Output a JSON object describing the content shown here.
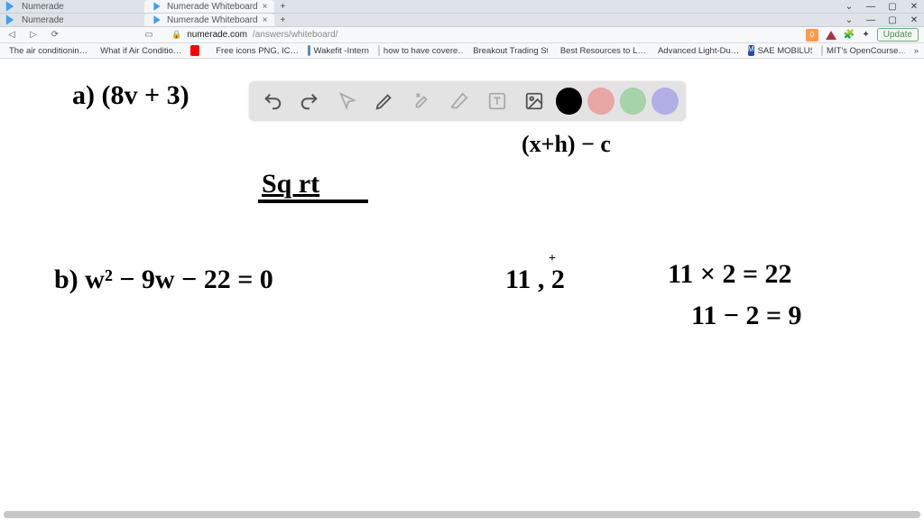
{
  "window_rows": [
    {
      "app_title": "Numerade",
      "tab_title": "Numerade Whiteboard"
    },
    {
      "app_title": "Numerade",
      "tab_title": "Numerade Whiteboard"
    }
  ],
  "window_buttons": {
    "down": "⌄",
    "min": "—",
    "max": "▢",
    "close": "✕"
  },
  "urlbar": {
    "back": "◁",
    "fwd": "▷",
    "reload": "⟳",
    "reader": "▭",
    "lock": "🔒",
    "domain": "numerade.com",
    "path": "/answers/whiteboard/",
    "shield": "0",
    "update_label": "Update"
  },
  "bookmarks": [
    {
      "label": "The air conditionin…",
      "color": "#2aa56a"
    },
    {
      "label": "What if Air Conditio…",
      "color": "#222"
    },
    {
      "label": "",
      "color": "#ff0000"
    },
    {
      "label": "Free icons PNG, IC…",
      "color": "#2bd46b"
    },
    {
      "label": "Wakefit -Intern",
      "color": "#5b89c9"
    },
    {
      "label": "how to have covere…",
      "color": "#4285f4"
    },
    {
      "label": "Breakout Trading St…",
      "color": "transparent"
    },
    {
      "label": "Best Resources to L…",
      "color": "#8866aa"
    },
    {
      "label": "Advanced Light-Du…",
      "color": "#3c9bd8"
    },
    {
      "label": "SAE MOBILUS",
      "color": "#1d4fa0"
    },
    {
      "label": "MIT's OpenCourse…",
      "color": "#4285f4"
    }
  ],
  "bookmarks_more": "»",
  "toolbar_icons": {
    "undo": "undo",
    "redo": "redo",
    "pointer": "pointer",
    "pen": "pen",
    "tools": "tools",
    "eraser": "eraser",
    "text": "text",
    "image": "image"
  },
  "handwriting": {
    "line_a": "a) (8v + 3)",
    "partial_top": "(x+h) − c",
    "sqrt_label": "Sq rt",
    "line_b": "b) w² − 9w − 22 = 0",
    "factors": "11 , 2",
    "factors_plus": "+",
    "mult": "11 × 2 = 22",
    "sub": "11 − 2 = 9"
  }
}
